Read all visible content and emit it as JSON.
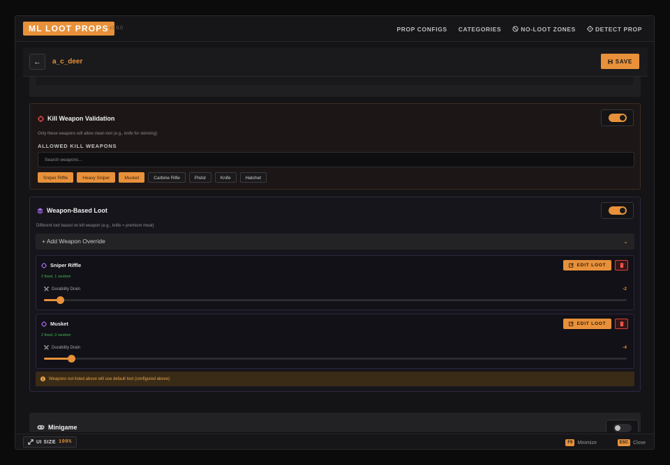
{
  "app": {
    "logo": "ML LOOT PROPS",
    "version": "v1.0.0"
  },
  "nav": {
    "items": [
      {
        "label": "PROP CONFIGS",
        "icon": ""
      },
      {
        "label": "CATEGORIES",
        "icon": ""
      },
      {
        "label": "NO-LOOT ZONES",
        "icon": "ban-icon"
      },
      {
        "label": "DETECT PROP",
        "icon": "crosshair-icon"
      }
    ]
  },
  "header": {
    "title": "a_c_deer",
    "save_label": "SAVE"
  },
  "kill_validation": {
    "title": "Kill Weapon Validation",
    "description": "Only these weapons will allow clean loot (e.g., knife for skinning)",
    "enabled": true,
    "section_label": "ALLOWED KILL WEAPONS",
    "search_placeholder": "Search weapons...",
    "weapons": [
      {
        "label": "Sniper Riffle",
        "selected": true
      },
      {
        "label": "Heavy Sniper",
        "selected": true
      },
      {
        "label": "Musket",
        "selected": true
      },
      {
        "label": "Carbine Rifle",
        "selected": false
      },
      {
        "label": "Pistol",
        "selected": false
      },
      {
        "label": "Knife",
        "selected": false
      },
      {
        "label": "Hatchet",
        "selected": false
      }
    ]
  },
  "weapon_loot": {
    "title": "Weapon-Based Loot",
    "description": "Different loot based on kill weapon (e.g., knife = premium meat)",
    "enabled": true,
    "add_override_label": "+ Add Weapon Override",
    "edit_label": "EDIT LOOT",
    "overrides": [
      {
        "name": "Sniper Riffle",
        "summary": "2 fixed, 1 random",
        "drain_label": "Durability Drain",
        "drain_value": "-2",
        "slider_fraction": 0.027
      },
      {
        "name": "Musket",
        "summary": "2 fixed, 0 random",
        "drain_label": "Durability Drain",
        "drain_value": "-4",
        "slider_fraction": 0.047
      }
    ],
    "note": "Weapons not listed above will use default loot (configured above)"
  },
  "minigame": {
    "title": "Minigame",
    "enabled": false
  },
  "footer": {
    "ui_size_label": "UI SIZE",
    "ui_size_value": "100%",
    "minimize_key": "F9",
    "minimize_label": "Minimize",
    "close_key": "ESC",
    "close_label": "Close"
  },
  "colors": {
    "accent": "#e8913a",
    "kill_icon": "#e5484d",
    "loot_icon": "#a86bf0",
    "success_text": "#3fb950"
  }
}
